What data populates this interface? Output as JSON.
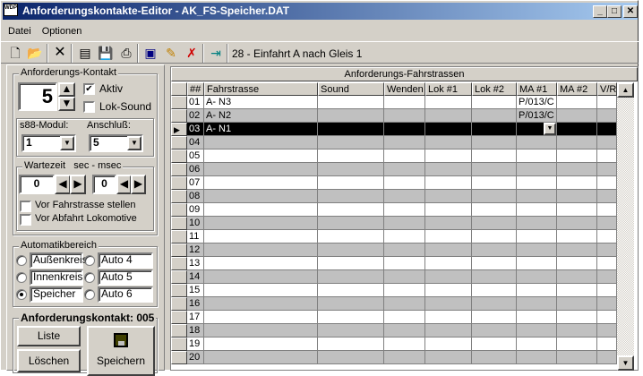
{
  "window": {
    "title": "Anforderungskontakte-Editor - AK_FS-Speicher.DAT",
    "icon_text": "WDP",
    "minimize": "_",
    "maximize": "□",
    "close": "✕"
  },
  "menu": [
    "Datei",
    "Optionen"
  ],
  "toolbar": {
    "status": "28 - Einfahrt A nach Gleis 1"
  },
  "kontakt": {
    "legend": "Anforderungs-Kontakt",
    "number": "5",
    "aktiv_label": "Aktiv",
    "aktiv": true,
    "loksound_label": "Lok-Sound",
    "loksound": false
  },
  "s88": {
    "modul_label": "s88-Modul:",
    "modul_value": "1",
    "anschluss_label": "Anschluß:",
    "anschluss_value": "5"
  },
  "wartezeit": {
    "legend": "Wartezeit   sec - msec",
    "sec": "0",
    "msec": "0",
    "opt1": "Vor Fahrstrasse stellen",
    "opt2": "Vor Abfahrt Lokomotive"
  },
  "automatik": {
    "legend": "Automatikbereich",
    "options": [
      "Außenkreis",
      "Innenkreis",
      "Speicher",
      "Auto 4",
      "Auto 5",
      "Auto 6"
    ],
    "selected": "Speicher"
  },
  "actions": {
    "legend": "Anforderungskontakt: 005",
    "liste": "Liste",
    "loeschen": "Löschen",
    "speichern": "Speichern"
  },
  "grid": {
    "title": "Anforderungs-Fahrstrassen",
    "columns": [
      "##",
      "Fahrstrasse",
      "Sound",
      "Wenden",
      "Lok #1",
      "Lok #2",
      "MA #1",
      "MA #2",
      "V/R"
    ],
    "selected_row": 2,
    "rows": [
      [
        "01",
        "A- N3",
        "",
        "",
        "",
        "",
        "P/013/C",
        "",
        ""
      ],
      [
        "02",
        "A- N2",
        "",
        "",
        "",
        "",
        "P/013/C",
        "",
        ""
      ],
      [
        "03",
        "A- N1",
        "",
        "",
        "",
        "",
        "",
        "",
        ""
      ],
      [
        "04"
      ],
      [
        "05"
      ],
      [
        "06"
      ],
      [
        "07"
      ],
      [
        "08"
      ],
      [
        "09"
      ],
      [
        "10"
      ],
      [
        "11"
      ],
      [
        "12"
      ],
      [
        "13"
      ],
      [
        "14"
      ],
      [
        "15"
      ],
      [
        "16"
      ],
      [
        "17"
      ],
      [
        "18"
      ],
      [
        "19"
      ],
      [
        "20"
      ]
    ]
  }
}
